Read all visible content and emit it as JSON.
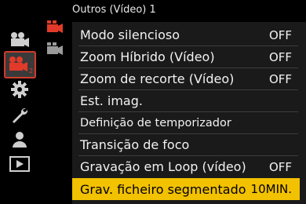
{
  "header": {
    "title": "Outros (Vídeo) 1"
  },
  "left_rail": [
    {
      "icon": "video-camera-icon-p1"
    },
    {
      "icon": "video-camera-icon-p2",
      "active": true,
      "badge": "2"
    },
    {
      "icon": "gear-icon"
    },
    {
      "icon": "wrench-icon"
    },
    {
      "icon": "person-icon"
    },
    {
      "icon": "playback-icon"
    }
  ],
  "sub_pages": [
    {
      "icon": "video-camera-red-icon",
      "active": true
    },
    {
      "icon": "video-camera-gray-icon",
      "active": false
    }
  ],
  "menu": {
    "items": [
      {
        "label": "Modo silencioso",
        "value": "OFF"
      },
      {
        "label": "Zoom Híbrido (Vídeo)",
        "value": "OFF"
      },
      {
        "label": "Zoom de recorte (Vídeo)",
        "value": "OFF"
      },
      {
        "label": "Est. imag.",
        "value": ""
      },
      {
        "label": "Definição de temporizador",
        "value": ""
      },
      {
        "label": "Transição de foco",
        "value": ""
      },
      {
        "label": "Gravação em Loop (vídeo)",
        "value": "OFF"
      },
      {
        "label": "Grav. ficheiro segmentado",
        "value": "10MIN.",
        "selected": true
      }
    ]
  },
  "colors": {
    "accent_red": "#d23b2b",
    "selection_yellow": "#f2c100"
  }
}
